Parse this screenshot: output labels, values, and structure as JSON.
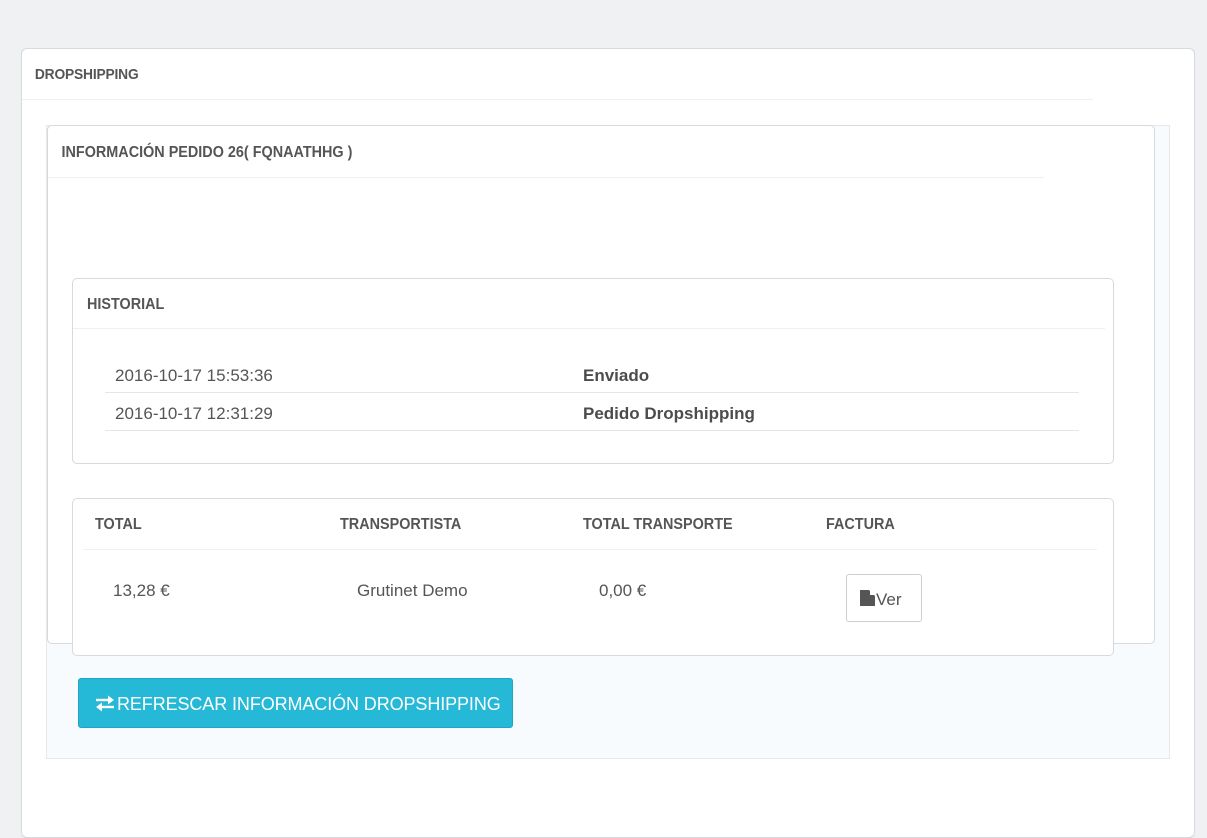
{
  "panel": {
    "title": "DROPSHIPPING"
  },
  "order": {
    "title": "INFORMACIÓN PEDIDO 26( FQNAATHHG )"
  },
  "history": {
    "title": "HISTORIAL",
    "rows": [
      {
        "date": "2016-10-17 15:53:36",
        "status": "Enviado"
      },
      {
        "date": "2016-10-17 12:31:29",
        "status": "Pedido Dropshipping"
      }
    ]
  },
  "totals": {
    "headers": {
      "total": "TOTAL",
      "carrier": "TRANSPORTISTA",
      "shipping": "TOTAL TRANSPORTE",
      "invoice": "FACTURA"
    },
    "values": {
      "total": "13,28 €",
      "carrier": "Grutinet Demo",
      "shipping": "0,00 €"
    },
    "invoice_button": "Ver",
    "invoice_icon": "file-icon"
  },
  "refresh_button": {
    "label": "REFRESCAR INFORMACIÓN DROPSHIPPING",
    "icon": "exchange-icon"
  },
  "colors": {
    "accent": "#25b9d7",
    "background": "#eff1f2"
  }
}
